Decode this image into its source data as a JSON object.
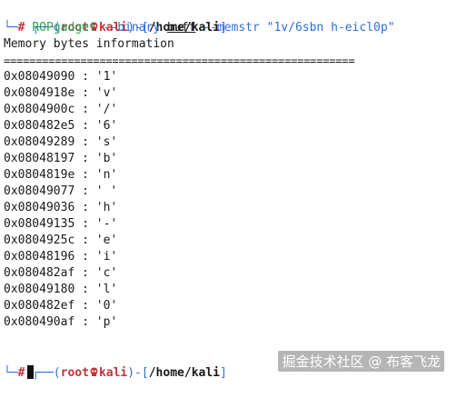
{
  "prompt": {
    "corner_top": "┌──(",
    "corner_bottom": "└─",
    "user": "root",
    "host": "kali",
    "path_open": ")-[",
    "path": "/home/kali",
    "path_close": "]",
    "hash": "#"
  },
  "command": {
    "program": "ROPgadget",
    "arg1": "--binary",
    "arg2": "buff",
    "arg3": "--memstr",
    "arg4": "\"1v/6sbn h-eicl0p\""
  },
  "output": {
    "heading": "Memory bytes information",
    "divider": "=======================================================",
    "rows": [
      {
        "addr": "0x08049090",
        "char": "'1'"
      },
      {
        "addr": "0x0804918e",
        "char": "'v'"
      },
      {
        "addr": "0x0804900c",
        "char": "'/'"
      },
      {
        "addr": "0x080482e5",
        "char": "'6'"
      },
      {
        "addr": "0x08049289",
        "char": "'s'"
      },
      {
        "addr": "0x08048197",
        "char": "'b'"
      },
      {
        "addr": "0x0804819e",
        "char": "'n'"
      },
      {
        "addr": "0x08049077",
        "char": "' '"
      },
      {
        "addr": "0x08049036",
        "char": "'h'"
      },
      {
        "addr": "0x08049135",
        "char": "'-'"
      },
      {
        "addr": "0x0804925c",
        "char": "'e'"
      },
      {
        "addr": "0x08048196",
        "char": "'i'"
      },
      {
        "addr": "0x080482af",
        "char": "'c'"
      },
      {
        "addr": "0x08049180",
        "char": "'l'"
      },
      {
        "addr": "0x080482ef",
        "char": "'0'"
      },
      {
        "addr": "0x080490af",
        "char": "'p'"
      }
    ],
    "separator": " : "
  },
  "watermark": "掘金技术社区 @ 布客飞龙",
  "colors": {
    "prompt_frame": "#2f6fd6",
    "user_host": "#c8303a",
    "command": "#2e9e57"
  }
}
